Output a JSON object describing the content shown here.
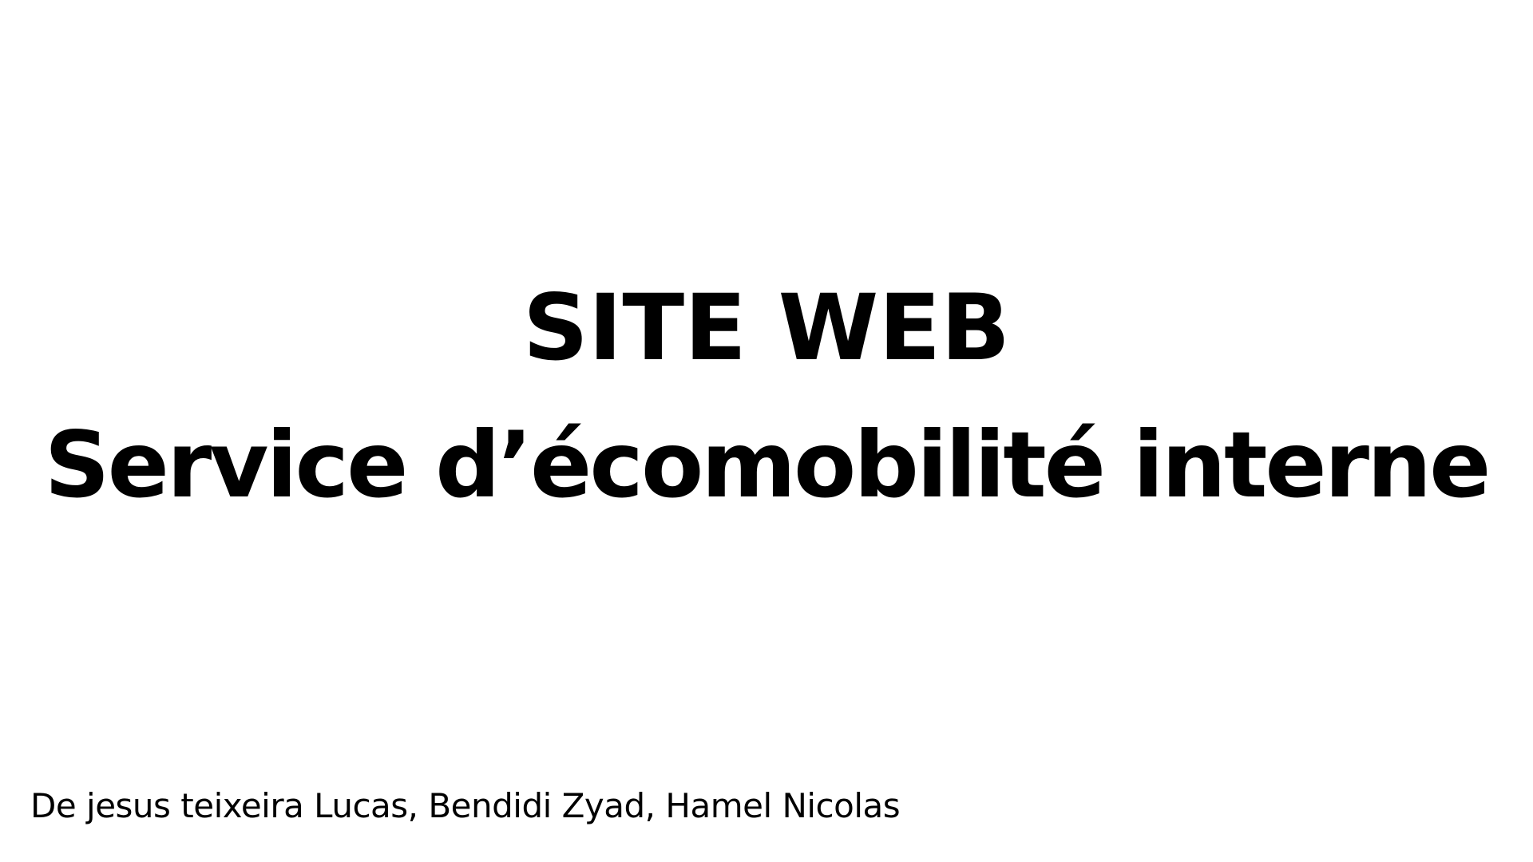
{
  "slide": {
    "title_line_1": "SITE WEB",
    "title_line_2": "Service d’écomobilité interne",
    "authors": "De jesus teixeira Lucas, Bendidi Zyad, Hamel Nicolas"
  },
  "colors": {
    "background": "#ffffff",
    "text": "#000000"
  }
}
